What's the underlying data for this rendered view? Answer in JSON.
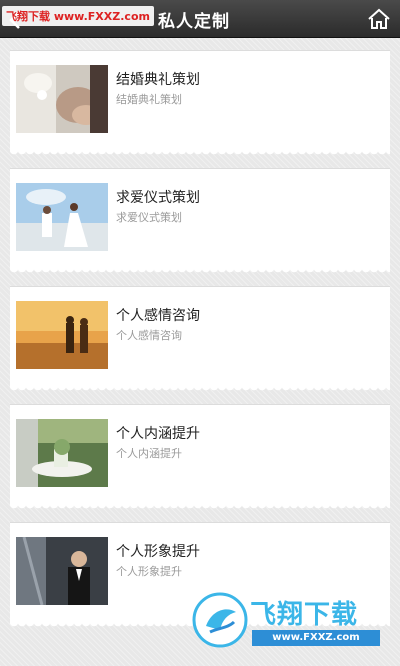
{
  "header": {
    "title": "私人定制",
    "back_icon": "back-arrow-icon",
    "home_icon": "home-icon",
    "watermark": "飞翔下载 www.FXXZ.com"
  },
  "items": [
    {
      "title": "结婚典礼策划",
      "subtitle": "结婚典礼策划",
      "image": "wedding-hands-photo"
    },
    {
      "title": "求爱仪式策划",
      "subtitle": "求爱仪式策划",
      "image": "proposal-beach-photo"
    },
    {
      "title": "个人感情咨询",
      "subtitle": "个人感情咨询",
      "image": "couple-sunset-photo"
    },
    {
      "title": "个人内涵提升",
      "subtitle": "个人内涵提升",
      "image": "garden-table-photo"
    },
    {
      "title": "个人形象提升",
      "subtitle": "个人形象提升",
      "image": "suit-portrait-photo"
    }
  ],
  "watermark_bottom": {
    "brand": "飞翔下载",
    "url": "www.FXXZ.com"
  },
  "colors": {
    "header": "#2f2f2f",
    "background": "#e8e8e8",
    "card": "#ffffff",
    "title_text": "#222222",
    "subtitle_text": "#9a9a9a",
    "watermark_blue": "#3bb6e8"
  }
}
